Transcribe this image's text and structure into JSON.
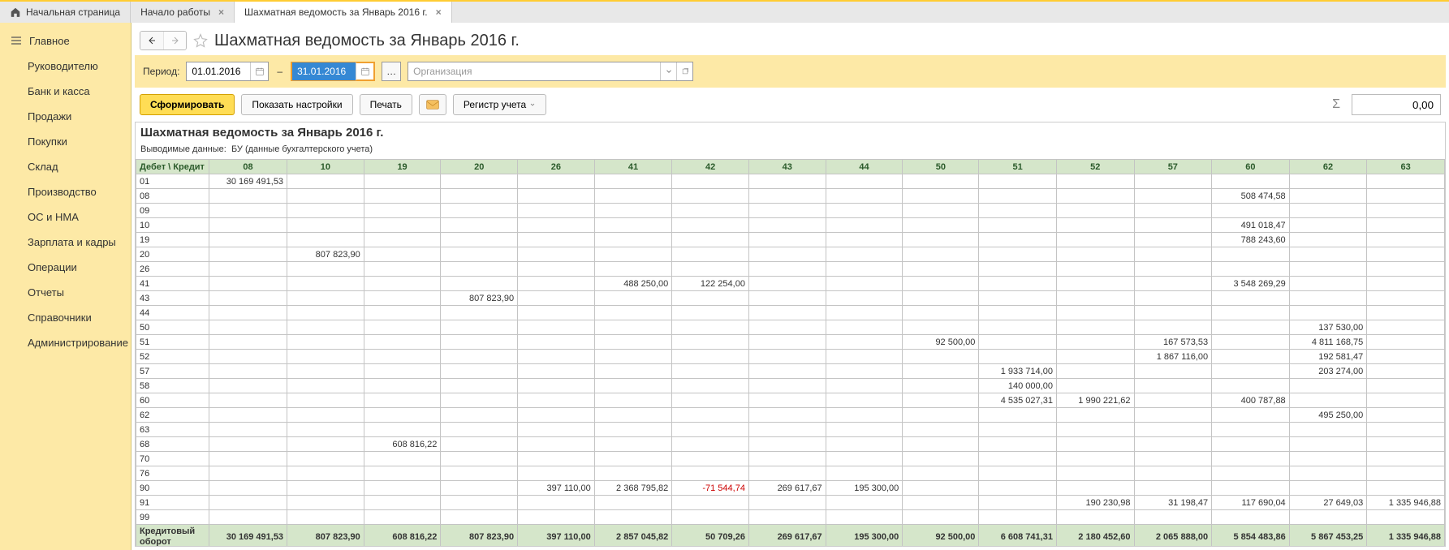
{
  "tabs": {
    "home": "Начальная страница",
    "t1": "Начало работы",
    "t2": "Шахматная ведомость за Январь 2016 г."
  },
  "sidebar": {
    "main": "Главное",
    "items": [
      "Руководителю",
      "Банк и касса",
      "Продажи",
      "Покупки",
      "Склад",
      "Производство",
      "ОС и НМА",
      "Зарплата и кадры",
      "Операции",
      "Отчеты",
      "Справочники",
      "Администрирование"
    ]
  },
  "header": {
    "title": "Шахматная ведомость за Январь 2016 г."
  },
  "filter": {
    "period_label": "Период:",
    "date_from": "01.01.2016",
    "date_to": "31.01.2016",
    "org_placeholder": "Организация"
  },
  "toolbar": {
    "form": "Сформировать",
    "show_settings": "Показать настройки",
    "print": "Печать",
    "register": "Регистр учета",
    "sum": "0,00"
  },
  "report": {
    "title": "Шахматная ведомость за Январь 2016 г.",
    "sub_label": "Выводимые данные:",
    "sub_value": "БУ (данные бухгалтерского учета)",
    "corner": "Дебет \\ Кредит",
    "columns": [
      "08",
      "10",
      "19",
      "20",
      "26",
      "41",
      "42",
      "43",
      "44",
      "50",
      "51",
      "52",
      "57",
      "60",
      "62",
      "63"
    ],
    "rows": [
      {
        "h": "01",
        "c": {
          "08": "30 169 491,53"
        }
      },
      {
        "h": "08",
        "c": {
          "60": "508 474,58"
        }
      },
      {
        "h": "09",
        "c": {}
      },
      {
        "h": "10",
        "c": {
          "60": "491 018,47"
        }
      },
      {
        "h": "19",
        "c": {
          "60": "788 243,60"
        }
      },
      {
        "h": "20",
        "c": {
          "10": "807 823,90"
        }
      },
      {
        "h": "26",
        "c": {}
      },
      {
        "h": "41",
        "c": {
          "41": "488 250,00",
          "42": "122 254,00",
          "60": "3 548 269,29"
        }
      },
      {
        "h": "43",
        "c": {
          "20": "807 823,90"
        }
      },
      {
        "h": "44",
        "c": {}
      },
      {
        "h": "50",
        "c": {
          "62": "137 530,00"
        }
      },
      {
        "h": "51",
        "c": {
          "50": "92 500,00",
          "57": "167 573,53",
          "62": "4 811 168,75"
        }
      },
      {
        "h": "52",
        "c": {
          "57": "1 867 116,00",
          "62": "192 581,47"
        }
      },
      {
        "h": "57",
        "c": {
          "51": "1 933 714,00",
          "62": "203 274,00"
        }
      },
      {
        "h": "58",
        "c": {
          "51": "140 000,00"
        }
      },
      {
        "h": "60",
        "c": {
          "51": "4 535 027,31",
          "52": "1 990 221,62",
          "60": "400 787,88"
        }
      },
      {
        "h": "62",
        "c": {
          "62": "495 250,00"
        }
      },
      {
        "h": "63",
        "c": {}
      },
      {
        "h": "68",
        "c": {
          "19": "608 816,22"
        }
      },
      {
        "h": "70",
        "c": {}
      },
      {
        "h": "76",
        "c": {}
      },
      {
        "h": "90",
        "c": {
          "26": "397 110,00",
          "41": "2 368 795,82",
          "42": "-71 544,74",
          "43": "269 617,67",
          "44": "195 300,00"
        }
      },
      {
        "h": "91",
        "c": {
          "52": "190 230,98",
          "57": "31 198,47",
          "60": "117 690,04",
          "62": "27 649,03",
          "63": "1 335 946,88"
        }
      },
      {
        "h": "99",
        "c": {}
      }
    ],
    "total_label": "Кредитовый оборот",
    "totals": {
      "08": "30 169 491,53",
      "10": "807 823,90",
      "19": "608 816,22",
      "20": "807 823,90",
      "26": "397 110,00",
      "41": "2 857 045,82",
      "42": "50 709,26",
      "43": "269 617,67",
      "44": "195 300,00",
      "50": "92 500,00",
      "51": "6 608 741,31",
      "52": "2 180 452,60",
      "57": "2 065 888,00",
      "60": "5 854 483,86",
      "62": "5 867 453,25",
      "63": "1 335 946,88"
    }
  }
}
